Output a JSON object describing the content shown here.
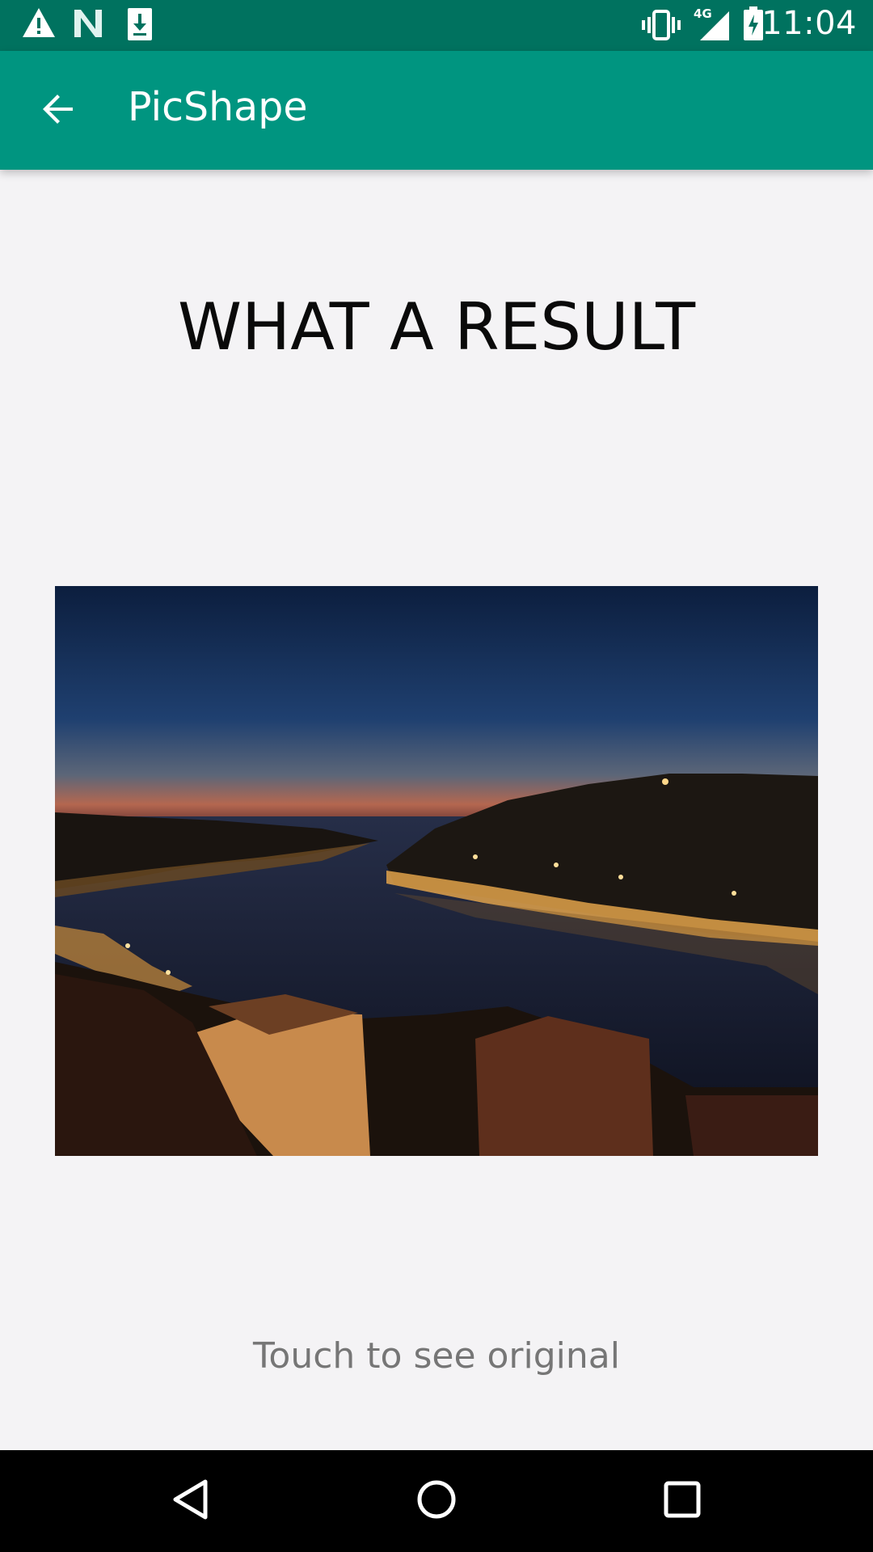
{
  "status_bar": {
    "time": "11:04",
    "network": "4G",
    "left_icons": [
      "warning-icon",
      "n-notification-icon",
      "download-icon"
    ],
    "right_icons": [
      "vibrate-icon",
      "signal-icon",
      "battery-charging-icon"
    ]
  },
  "app_bar": {
    "title": "PicShape",
    "back_icon": "arrow-back-icon",
    "color": "#009580",
    "status_color": "#00725f"
  },
  "main": {
    "headline": "WHAT A RESULT",
    "image": "night-river-city-photo",
    "hint": "Touch to see original"
  },
  "nav_bar": {
    "icons": [
      "back-triangle-icon",
      "home-circle-icon",
      "recents-square-icon"
    ]
  }
}
